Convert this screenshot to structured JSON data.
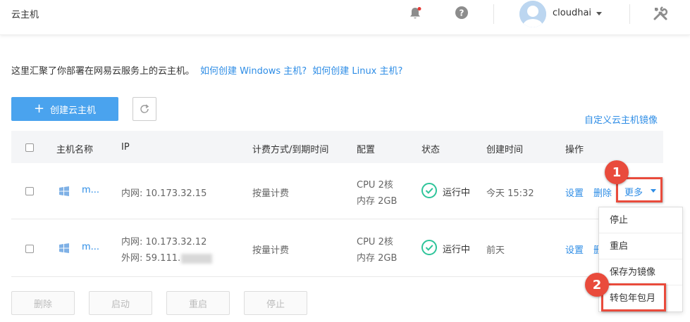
{
  "header": {
    "title": "云主机",
    "username": "cloudhai"
  },
  "intro": {
    "text": "这里汇聚了你部署在网易云服务上的云主机。",
    "link_windows": "如何创建 Windows 主机?",
    "link_linux": "如何创建 Linux 主机?"
  },
  "toolbar": {
    "create_label": "创建云主机",
    "custom_image_link": "自定义云主机镜像"
  },
  "table": {
    "columns": [
      "主机名称",
      "IP",
      "计费方式/到期时间",
      "配置",
      "状态",
      "创建时间",
      "操作"
    ],
    "rows": [
      {
        "name": "m...",
        "ip_internal": "内网:  10.173.32.15",
        "ip_external": "",
        "billing": "按量计费",
        "cpu": "CPU 2核",
        "memory": "内存 2GB",
        "status": "运行中",
        "created": "今天 15:32",
        "op_settings": "设置",
        "op_delete": "删除",
        "op_more": "更多"
      },
      {
        "name": "m...",
        "ip_internal": "内网:  10.173.32.12",
        "ip_external": "外网:  59.111.",
        "billing": "按量计费",
        "cpu": "CPU 2核",
        "memory": "内存 2GB",
        "status": "运行中",
        "created": "前天",
        "op_settings": "设置",
        "op_delete": "删除"
      }
    ]
  },
  "dropdown": {
    "items": [
      "停止",
      "重启",
      "保存为镜像",
      "转包年包月"
    ]
  },
  "annotations": {
    "badge1": "1",
    "badge2": "2"
  },
  "bottom_buttons": [
    "删除",
    "启动",
    "重启",
    "停止"
  ],
  "colors": {
    "accent": "#2e8de6",
    "create_button": "#4aa3ee",
    "running_green": "#2ec49a",
    "highlight_red": "#e94b3c"
  },
  "icons": {
    "bell": "bell-icon",
    "help": "help-icon",
    "tools": "tools-icon",
    "refresh": "refresh-icon",
    "os": "windows-icon",
    "status": "check-circle-icon"
  }
}
